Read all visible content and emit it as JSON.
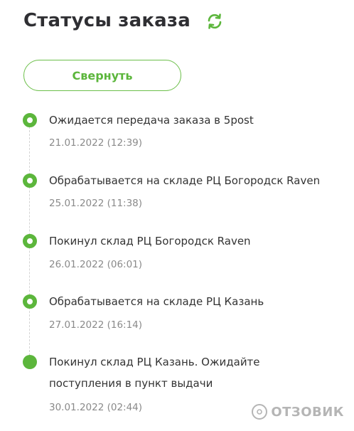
{
  "header": {
    "title": "Статусы заказа",
    "refresh_icon": "refresh-icon"
  },
  "actions": {
    "collapse_label": "Свернуть"
  },
  "statuses": [
    {
      "text": "Ожидается передача заказа в 5post",
      "date": "21.01.2022 (12:39)",
      "current": false
    },
    {
      "text": "Обрабатывается на складе РЦ Богородск Raven",
      "date": "25.01.2022 (11:38)",
      "current": false
    },
    {
      "text": "Покинул склад РЦ Богородск Raven",
      "date": "26.01.2022 (06:01)",
      "current": false
    },
    {
      "text": "Обрабатывается на складе РЦ Казань",
      "date": "27.01.2022 (16:14)",
      "current": false
    },
    {
      "text": "Покинул склад РЦ Казань. Ожидайте поступления в пункт выдачи",
      "date": "30.01.2022 (02:44)",
      "current": true
    }
  ],
  "watermark": {
    "text": "ОТЗОВИК"
  },
  "colors": {
    "accent": "#5cb63c",
    "text": "#333333",
    "muted": "#8a8a8a"
  }
}
